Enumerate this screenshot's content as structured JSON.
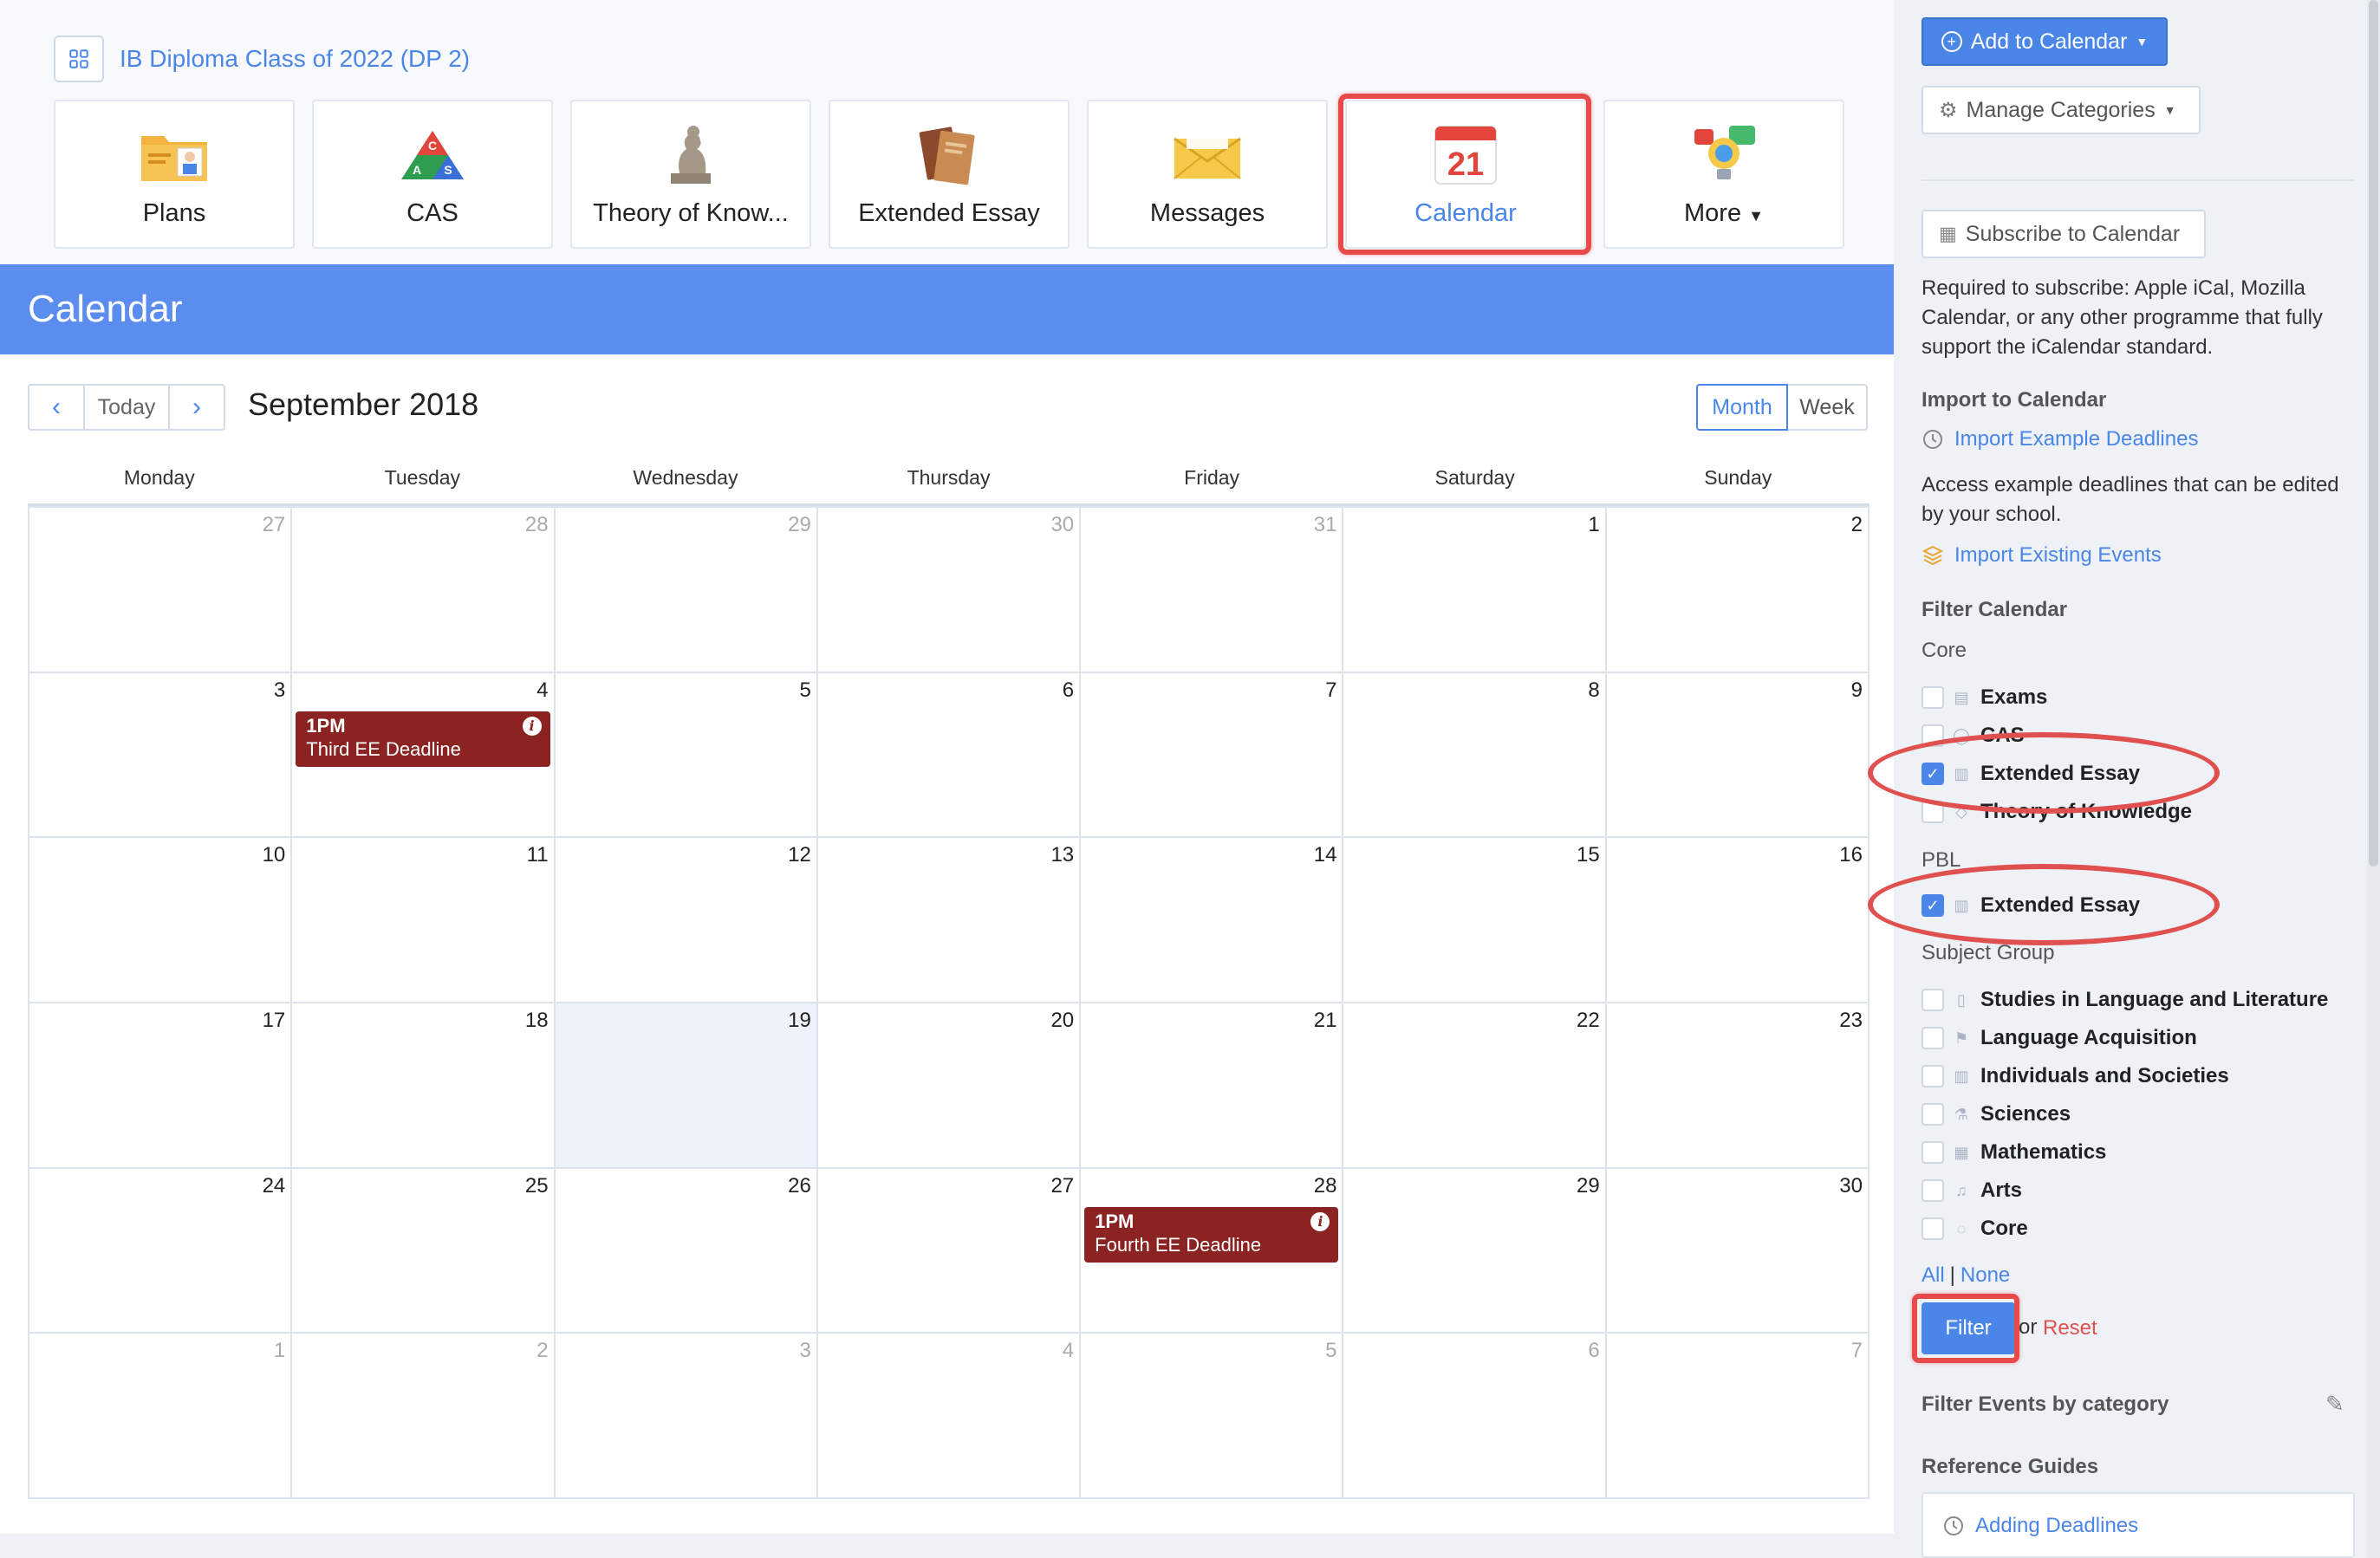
{
  "class_header": {
    "title": "IB Diploma Class of 2022 (DP 2)"
  },
  "modules": [
    {
      "label": "Plans",
      "icon": "folder-plans-icon"
    },
    {
      "label": "CAS",
      "icon": "cas-triangle-icon"
    },
    {
      "label": "Theory of Know...",
      "icon": "thinker-statue-icon"
    },
    {
      "label": "Extended Essay",
      "icon": "books-icon"
    },
    {
      "label": "Messages",
      "icon": "envelope-icon"
    },
    {
      "label": "Calendar",
      "icon": "calendar-21-icon",
      "active": true
    },
    {
      "label": "More",
      "icon": "lightbulb-chat-icon"
    }
  ],
  "calendar": {
    "banner_title": "Calendar",
    "today_label": "Today",
    "month_title": "September 2018",
    "views": {
      "month": "Month",
      "week": "Week"
    },
    "weekdays": [
      "Monday",
      "Tuesday",
      "Wednesday",
      "Thursday",
      "Friday",
      "Saturday",
      "Sunday"
    ],
    "days": [
      {
        "n": "27",
        "other": true
      },
      {
        "n": "28",
        "other": true
      },
      {
        "n": "29",
        "other": true
      },
      {
        "n": "30",
        "other": true
      },
      {
        "n": "31",
        "other": true
      },
      {
        "n": "1"
      },
      {
        "n": "2"
      },
      {
        "n": "3"
      },
      {
        "n": "4",
        "event": {
          "time": "1PM",
          "title": "Third EE Deadline"
        }
      },
      {
        "n": "5"
      },
      {
        "n": "6"
      },
      {
        "n": "7"
      },
      {
        "n": "8"
      },
      {
        "n": "9"
      },
      {
        "n": "10"
      },
      {
        "n": "11"
      },
      {
        "n": "12"
      },
      {
        "n": "13"
      },
      {
        "n": "14"
      },
      {
        "n": "15"
      },
      {
        "n": "16"
      },
      {
        "n": "17"
      },
      {
        "n": "18"
      },
      {
        "n": "19",
        "today": true
      },
      {
        "n": "20"
      },
      {
        "n": "21"
      },
      {
        "n": "22"
      },
      {
        "n": "23"
      },
      {
        "n": "24"
      },
      {
        "n": "25"
      },
      {
        "n": "26"
      },
      {
        "n": "27"
      },
      {
        "n": "28",
        "event": {
          "time": "1PM",
          "title": "Fourth EE Deadline"
        }
      },
      {
        "n": "29"
      },
      {
        "n": "30"
      },
      {
        "n": "1",
        "other": true
      },
      {
        "n": "2",
        "other": true
      },
      {
        "n": "3",
        "other": true
      },
      {
        "n": "4",
        "other": true
      },
      {
        "n": "5",
        "other": true
      },
      {
        "n": "6",
        "other": true
      },
      {
        "n": "7",
        "other": true
      }
    ],
    "event_color": "#8b2323"
  },
  "sidebar": {
    "add_to_calendar": "Add to Calendar",
    "manage_categories": "Manage Categories",
    "subscribe": "Subscribe to Calendar",
    "subscribe_note": "Required to subscribe: Apple iCal, Mozilla Calendar, or any other programme that fully support the iCalendar standard.",
    "import_heading": "Import to Calendar",
    "import_example": "Import Example Deadlines",
    "import_example_note": "Access example deadlines that can be edited by your school.",
    "import_existing": "Import Existing Events",
    "filter_heading": "Filter Calendar",
    "core_label": "Core",
    "core_items": [
      {
        "label": "Exams",
        "checked": false,
        "icon": "exam-calendar-icon"
      },
      {
        "label": "CAS",
        "checked": false,
        "icon": "cas-icon"
      },
      {
        "label": "Extended Essay",
        "checked": true,
        "icon": "essay-doc-icon"
      },
      {
        "label": "Theory of Knowledge",
        "checked": false,
        "icon": "tok-icon"
      }
    ],
    "pbl_label": "PBL",
    "pbl_items": [
      {
        "label": "Extended Essay",
        "checked": true,
        "icon": "essay-doc-icon"
      }
    ],
    "subject_label": "Subject Group",
    "subject_items": [
      {
        "label": "Studies in Language and Literature",
        "checked": false,
        "icon": "book-open-icon"
      },
      {
        "label": "Language Acquisition",
        "checked": false,
        "icon": "flag-icon"
      },
      {
        "label": "Individuals and Societies",
        "checked": false,
        "icon": "building-icon"
      },
      {
        "label": "Sciences",
        "checked": false,
        "icon": "flask-icon"
      },
      {
        "label": "Mathematics",
        "checked": false,
        "icon": "calculator-icon"
      },
      {
        "label": "Arts",
        "checked": false,
        "icon": "music-note-icon"
      },
      {
        "label": "Core",
        "checked": false,
        "icon": "lightbulb-icon"
      }
    ],
    "all_label": "All",
    "separator": "|",
    "none_label": "None",
    "filter_button": "Filter",
    "or_text": "or",
    "reset_label": "Reset",
    "filter_by_category": "Filter Events by category",
    "reference_heading": "Reference Guides",
    "adding_deadlines": "Adding Deadlines",
    "accent_color": "#4a86e8",
    "reset_color": "#e0504e"
  }
}
